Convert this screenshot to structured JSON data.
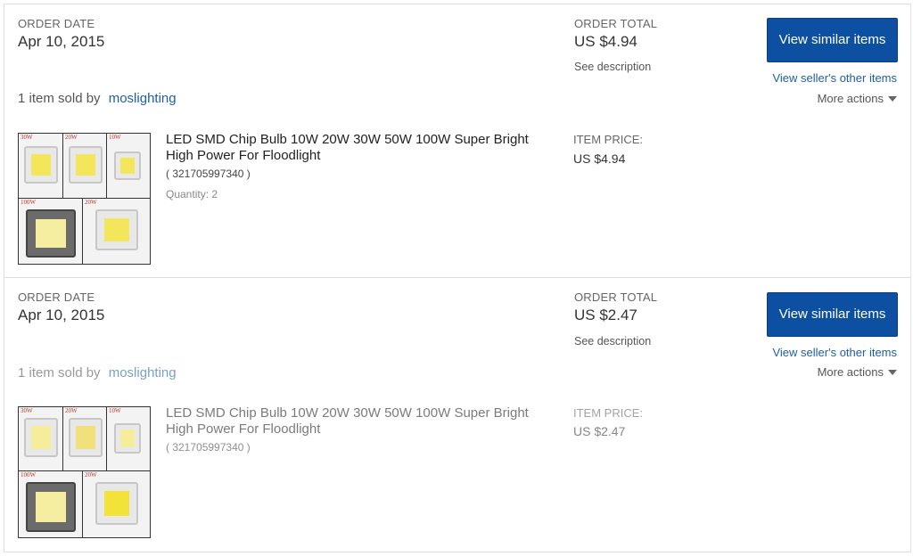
{
  "orders": [
    {
      "order_date_label": "ORDER DATE",
      "order_date": "Apr 10, 2015",
      "order_total_label": "ORDER TOTAL",
      "order_total": "US $4.94",
      "see_description": "See description",
      "view_similar": "View similar items",
      "view_seller_items": "View seller's other items",
      "more_actions": "More actions",
      "sold_by_text": "1 item sold by",
      "seller": "moslighting",
      "item": {
        "title": "LED SMD Chip Bulb 10W 20W 30W 50W 100W Super Bright High Power For Floodlight",
        "item_id": "( 321705997340 )",
        "quantity": "Quantity: 2",
        "price_label": "ITEM PRICE:",
        "price": "US $4.94",
        "thumb_tags": [
          "30W",
          "20W",
          "10W",
          "100W",
          "20W"
        ]
      }
    },
    {
      "order_date_label": "ORDER DATE",
      "order_date": "Apr 10, 2015",
      "order_total_label": "ORDER TOTAL",
      "order_total": "US $2.47",
      "see_description": "See description",
      "view_similar": "View similar items",
      "view_seller_items": "View seller's other items",
      "more_actions": "More actions",
      "sold_by_text": "1 item sold by",
      "seller": "moslighting",
      "item": {
        "title": "LED SMD Chip Bulb 10W 20W 30W 50W 100W Super Bright High Power For Floodlight",
        "item_id": "( 321705997340 )",
        "price_label": "ITEM PRICE:",
        "price": "US $2.47",
        "thumb_tags": [
          "30W",
          "20W",
          "10W",
          "100W",
          "20W"
        ]
      }
    }
  ],
  "colors": {
    "button_bg": "#0d4fa0",
    "link": "#1f5ea8",
    "chip_yellow": "#f4e65a"
  }
}
